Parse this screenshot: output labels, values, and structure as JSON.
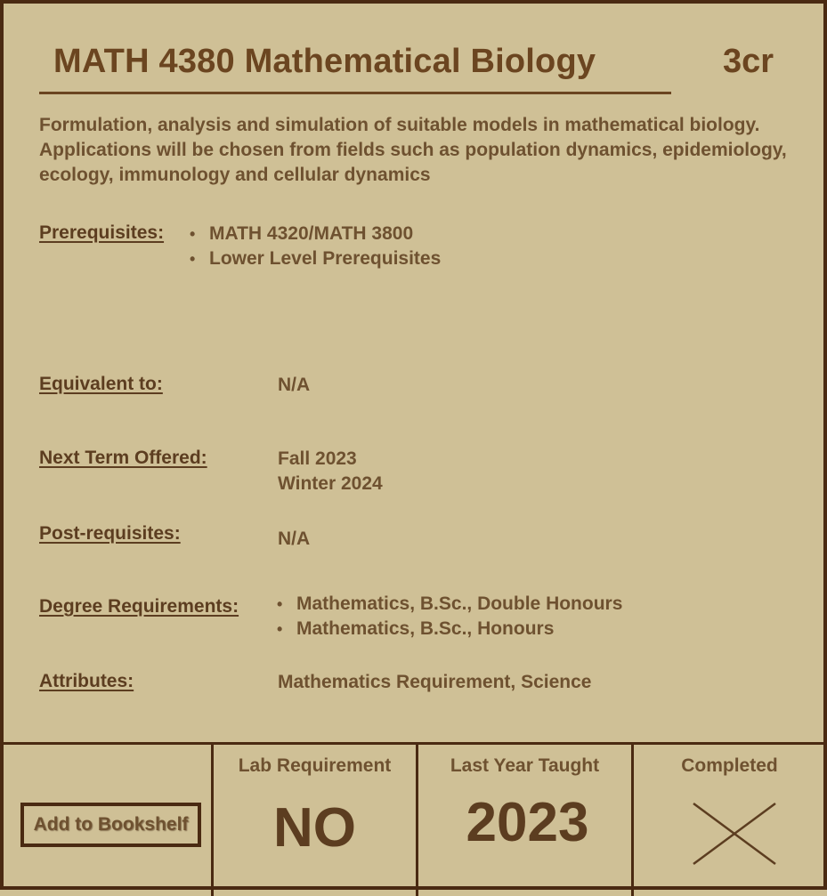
{
  "course": {
    "title": "MATH 4380 Mathematical Biology",
    "credits": "3cr",
    "description": "Formulation, analysis and simulation of suitable models in mathematical biology. Applications will be chosen from fields such as population dynamics, epidemiology, ecology, immunology and cellular dynamics"
  },
  "prerequisites": {
    "label": "Prerequisites:",
    "items": [
      "MATH 4320/MATH 3800",
      "Lower Level Prerequisites"
    ]
  },
  "equivalent": {
    "label": "Equivalent to:",
    "value": "N/A"
  },
  "next_term": {
    "label": "Next Term Offered:",
    "values": [
      "Fall 2023",
      "Winter 2024"
    ]
  },
  "postrequisites": {
    "label": "Post-requisites:",
    "value": "N/A"
  },
  "degree_requirements": {
    "label": "Degree Requirements:",
    "items": [
      "Mathematics, B.Sc., Double Honours",
      "Mathematics, B.Sc., Honours"
    ]
  },
  "attributes": {
    "label": "Attributes:",
    "value": "Mathematics Requirement, Science"
  },
  "footer": {
    "add_button": "Add to Bookshelf",
    "lab_label": "Lab Requirement",
    "lab_value": "NO",
    "last_year_label": "Last Year Taught",
    "last_year_value": "2023",
    "completed_label": "Completed",
    "completed_icon": "x-mark-icon"
  },
  "colors": {
    "background": "#cfc096",
    "text": "#5c3d20",
    "border": "#4a2a12"
  }
}
